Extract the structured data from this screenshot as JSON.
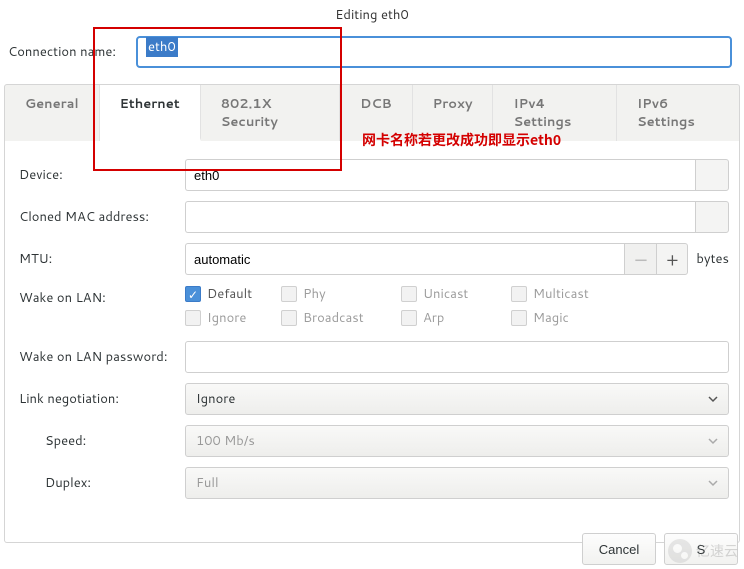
{
  "title": "Editing eth0",
  "connection_name_label": "Connection name:",
  "connection_name_value": "eth0",
  "tabs": {
    "general": "General",
    "ethernet": "Ethernet",
    "security": "802.1X Security",
    "dcb": "DCB",
    "proxy": "Proxy",
    "ipv4": "IPv4 Settings",
    "ipv6": "IPv6 Settings"
  },
  "active_tab": "ethernet",
  "fields": {
    "device_label": "Device:",
    "device_value": "eth0",
    "cloned_mac_label": "Cloned MAC address:",
    "cloned_mac_value": "",
    "mtu_label": "MTU:",
    "mtu_value": "automatic",
    "mtu_unit": "bytes",
    "wol_label": "Wake on LAN:",
    "wol_password_label": "Wake on LAN password:",
    "wol_password_value": "",
    "link_neg_label": "Link negotiation:",
    "link_neg_value": "Ignore",
    "speed_label": "Speed:",
    "speed_value": "100 Mb/s",
    "duplex_label": "Duplex:",
    "duplex_value": "Full"
  },
  "wol_options": {
    "default": "Default",
    "phy": "Phy",
    "unicast": "Unicast",
    "multicast": "Multicast",
    "ignore": "Ignore",
    "broadcast": "Broadcast",
    "arp": "Arp",
    "magic": "Magic"
  },
  "wol_checked": [
    "default"
  ],
  "footer": {
    "cancel": "Cancel",
    "save": "S"
  },
  "annotation": "网卡名称若更改成功即显示eth0",
  "watermark": "亿速云"
}
